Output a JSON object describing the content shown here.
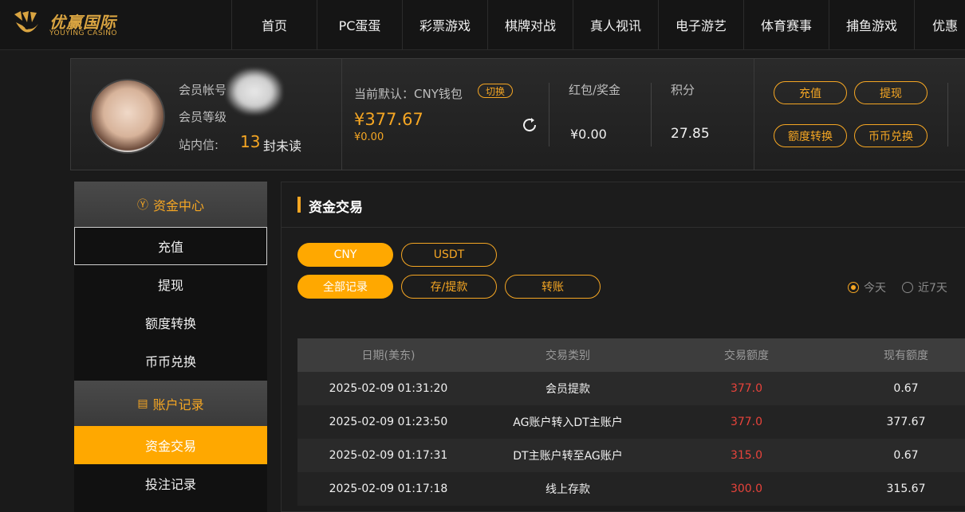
{
  "brand": {
    "name_cn": "优赢国际",
    "name_en": "YOUYING CASINO",
    "gold": "#d9a441"
  },
  "nav": [
    "首页",
    "PC蛋蛋",
    "彩票游戏",
    "棋牌对战",
    "真人视讯",
    "电子游艺",
    "体育赛事",
    "捕鱼游戏",
    "优惠"
  ],
  "member": {
    "account_label": "会员帐号",
    "level_label": "会员等级",
    "inbox_label": "站内信:",
    "unread_count": "13",
    "unread_unit": "封未读"
  },
  "wallet": {
    "default_label": "当前默认：CNY钱包",
    "switch_label": "切换",
    "balance": "¥377.67",
    "balance_sub": "¥0.00",
    "bonus_label": "红包/奖金",
    "bonus_value": "¥0.00",
    "points_label": "积分",
    "points_value": "27.85"
  },
  "actions": [
    "充值",
    "提现",
    "额度转换",
    "币币兑换"
  ],
  "sidebar": {
    "funds_header": "资金中心",
    "funds_items": [
      "充值",
      "提现",
      "额度转换",
      "币币兑换"
    ],
    "records_header": "账户记录",
    "records_items": [
      "资金交易",
      "投注记录"
    ]
  },
  "main": {
    "title": "资金交易",
    "currency_tabs": [
      "CNY",
      "USDT"
    ],
    "type_tabs": [
      "全部记录",
      "存/提款",
      "转账"
    ],
    "range_options": [
      "今天",
      "近7天"
    ],
    "columns": [
      "日期(美东)",
      "交易类别",
      "交易额度",
      "现有额度"
    ],
    "rows": [
      {
        "date": "2025-02-09 01:31:20",
        "type": "会员提款",
        "amount": "377.0",
        "balance": "0.67"
      },
      {
        "date": "2025-02-09 01:23:50",
        "type": "AG账户转入DT主账户",
        "amount": "377.0",
        "balance": "377.67"
      },
      {
        "date": "2025-02-09 01:17:31",
        "type": "DT主账户转至AG账户",
        "amount": "315.0",
        "balance": "0.67"
      },
      {
        "date": "2025-02-09 01:17:18",
        "type": "线上存款",
        "amount": "300.0",
        "balance": "315.67"
      }
    ]
  },
  "colors": {
    "accent": "#ffa800",
    "negative": "#e8433b"
  }
}
